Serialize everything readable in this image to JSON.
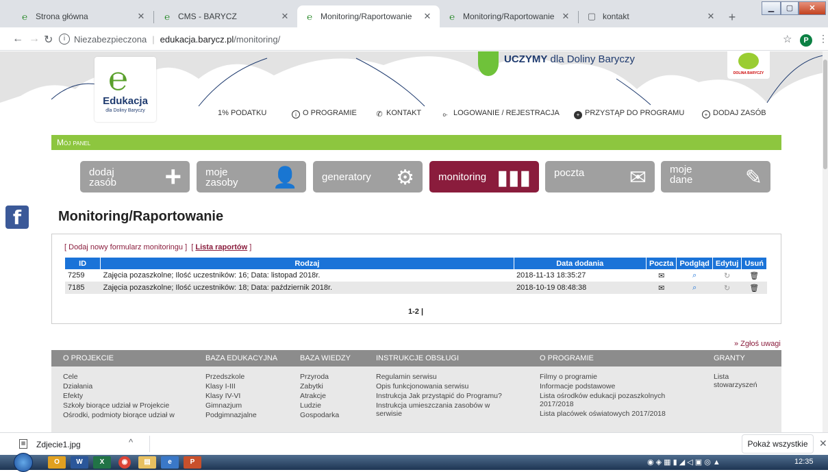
{
  "browser": {
    "tabs": [
      {
        "title": "Strona główna",
        "active": false
      },
      {
        "title": "CMS - BARYCZ",
        "active": false
      },
      {
        "title": "Monitoring/Raportowanie",
        "active": true
      },
      {
        "title": "Monitoring/Raportowanie",
        "active": false
      },
      {
        "title": "kontakt",
        "active": false
      }
    ],
    "security_label": "Niezabezpieczona",
    "url_host": "edukacja.barycz.pl",
    "url_path": "/monitoring/",
    "profile_initial": "P"
  },
  "header": {
    "logo_word": "Edukacja",
    "logo_sub": "dla Doliny Baryczy",
    "slogan_bold": "UCZYMY",
    "slogan_rest": " dla Doliny Baryczy",
    "right_logo_text": "DOLINA BARYCZY"
  },
  "topnav": [
    {
      "label": "1% PODATKU"
    },
    {
      "label": "O PROGRAMIE"
    },
    {
      "label": "KONTAKT"
    },
    {
      "label": "LOGOWANIE / REJESTRACJA"
    },
    {
      "label": "PRZYSTĄP DO PROGRAMU"
    },
    {
      "label": "DODAJ ZASÓB"
    }
  ],
  "panel_title": "Mój panel",
  "panel_buttons": [
    {
      "label": "dodaj\nzasób"
    },
    {
      "label": "moje\nzasoby"
    },
    {
      "label": "generatory"
    },
    {
      "label": "monitoring"
    },
    {
      "label": "poczta"
    },
    {
      "label": "moje\ndane"
    }
  ],
  "page_title": "Monitoring/Raportowanie",
  "actions": {
    "add_form": "Dodaj nowy formularz monitoringu",
    "report_list": "Lista raportów"
  },
  "table": {
    "headers": [
      "ID",
      "Rodzaj",
      "Data dodania",
      "Poczta",
      "Podgląd",
      "Edytuj",
      "Usuń"
    ],
    "rows": [
      {
        "id": "7259",
        "type": "Zajęcia pozaszkolne; Ilość uczestników: 16; Data: listopad 2018r.",
        "date": "2018-11-13 18:35:27"
      },
      {
        "id": "7185",
        "type": "Zajęcia pozaszkolne; Ilość uczestników: 18; Data: październik 2018r.",
        "date": "2018-10-19 08:48:38"
      }
    ]
  },
  "pager": "1-2 |",
  "report_issue": "» Zgłoś uwagi",
  "footer": {
    "columns": [
      {
        "heading": "O PROJEKCIE",
        "items": [
          "Cele",
          "Działania",
          "Efekty",
          "Szkoły biorące udział w Projekcie",
          "Ośrodki, podmioty biorące udział w"
        ]
      },
      {
        "heading": "BAZA EDUKACYJNA",
        "items": [
          "Przedszkole",
          "Klasy I-III",
          "Klasy IV-VI",
          "Gimnazjum",
          "Podgimnazjalne"
        ]
      },
      {
        "heading": "BAZA WIEDZY",
        "items": [
          "Przyroda",
          "Zabytki",
          "Atrakcje",
          "Ludzie",
          "Gospodarka"
        ]
      },
      {
        "heading": "INSTRUKCJE OBSŁUGI",
        "items": [
          "Regulamin serwisu",
          "Opis funkcjonowania serwisu",
          "Instrukcja Jak przystąpić do Programu?",
          "Instrukcja umieszczania zasobów w\nserwisie"
        ]
      },
      {
        "heading": "O PROGRAMIE",
        "items": [
          "Filmy o programie",
          "Informacje podstawowe",
          "Lista ośrodków edukacji pozaszkolnych\n2017/2018",
          "Lista placówek oświatowych 2017/2018"
        ]
      },
      {
        "heading": "GRANTY",
        "items": [
          "Lista\nstowarzyszeń"
        ]
      }
    ]
  },
  "download": {
    "filename": "Zdjecie1.jpg",
    "show_all": "Pokaż wszystkie"
  },
  "taskbar": {
    "clock": "12:35"
  }
}
